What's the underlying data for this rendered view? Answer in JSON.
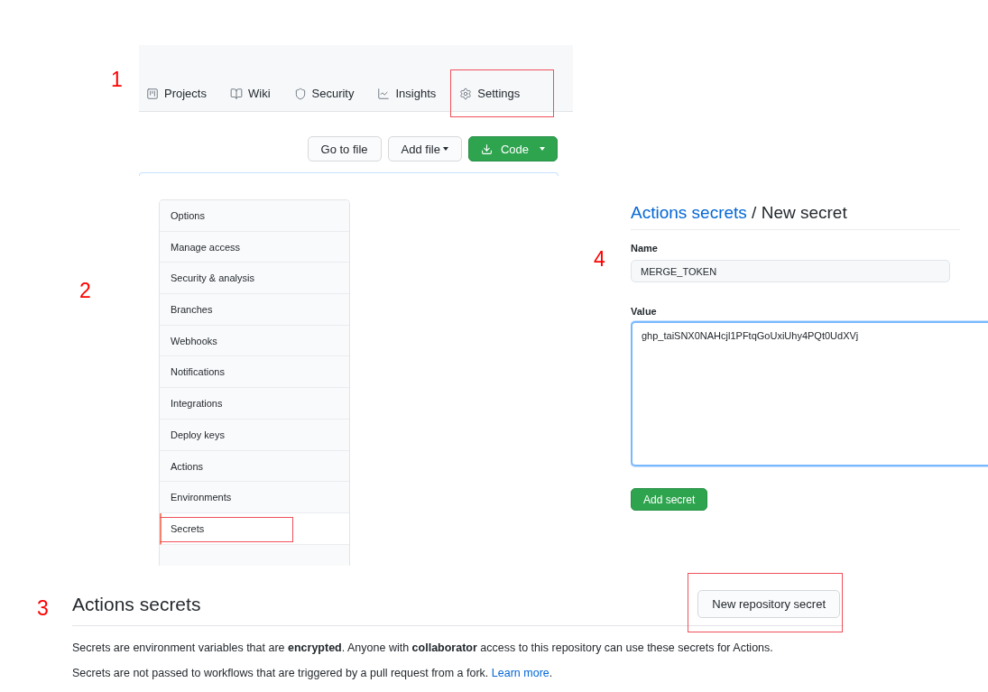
{
  "repo_header": {
    "step": "1",
    "tabs": [
      {
        "label": "Projects",
        "highlighted": false
      },
      {
        "label": "Wiki",
        "highlighted": false
      },
      {
        "label": "Security",
        "highlighted": false
      },
      {
        "label": "Insights",
        "highlighted": false
      },
      {
        "label": "Settings",
        "highlighted": true
      }
    ],
    "buttons": [
      {
        "label": "Go to file",
        "kind": "plain"
      },
      {
        "label": "Add file",
        "kind": "dropdown"
      },
      {
        "label": "Code",
        "kind": "primary"
      }
    ]
  },
  "settings_menu": {
    "step": "2",
    "items": [
      {
        "label": "Options",
        "selected": false,
        "highlighted": false
      },
      {
        "label": "Manage access",
        "selected": false,
        "highlighted": false
      },
      {
        "label": "Security & analysis",
        "selected": false,
        "highlighted": false
      },
      {
        "label": "Branches",
        "selected": false,
        "highlighted": false
      },
      {
        "label": "Webhooks",
        "selected": false,
        "highlighted": false
      },
      {
        "label": "Notifications",
        "selected": false,
        "highlighted": false
      },
      {
        "label": "Integrations",
        "selected": false,
        "highlighted": false
      },
      {
        "label": "Deploy keys",
        "selected": false,
        "highlighted": false
      },
      {
        "label": "Actions",
        "selected": false,
        "highlighted": false
      },
      {
        "label": "Environments",
        "selected": false,
        "highlighted": false
      },
      {
        "label": "Secrets",
        "selected": true,
        "highlighted": true
      }
    ]
  },
  "secrets_section": {
    "step": "3",
    "title": "Actions secrets",
    "button": {
      "label": "New repository secret",
      "highlighted": true
    },
    "description": "Secrets are environment variables that are **encrypted**. Anyone with **collaborator** access to this repository can use these secrets for Actions.",
    "note": {
      "text": "Secrets are not passed to workflows that are triggered by a pull request from a fork.",
      "link": "Learn more",
      "after": "."
    }
  },
  "new_secret_form": {
    "step": "4",
    "breadcrumb_link": "Actions secrets",
    "breadcrumb_current": "/ New secret",
    "name_label": "Name",
    "name_value": "MERGE_TOKEN",
    "value_label": "Value",
    "value_value": "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",
    "value_focused": true,
    "submit": "Add secret"
  }
}
